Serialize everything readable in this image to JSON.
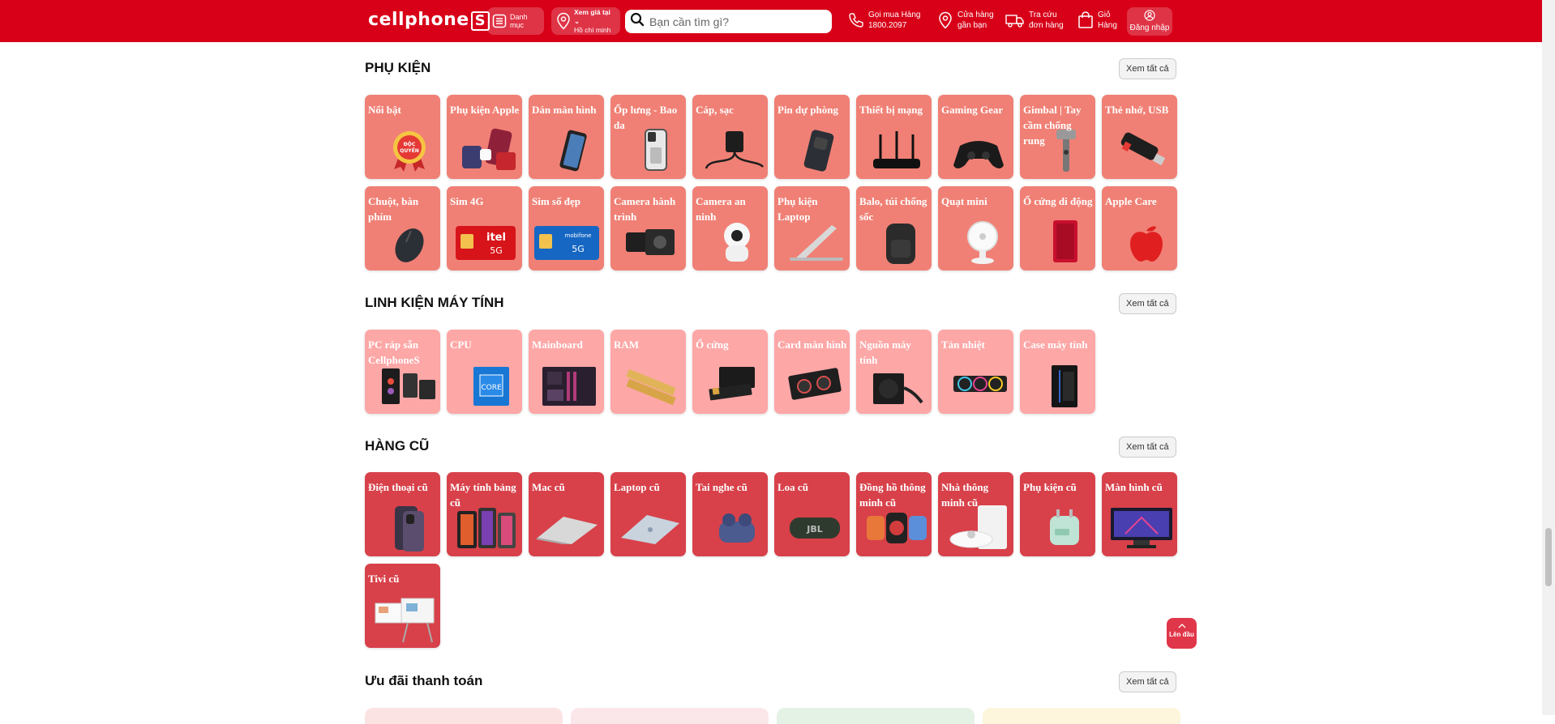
{
  "header": {
    "logo": "cellphone",
    "logo_mark": "S",
    "menu_label": "Danh mục",
    "location_line1": "Xem giá tại",
    "location_line2": "Hồ chí minh",
    "search_placeholder": "Bạn cần tìm gì?",
    "call_line1": "Gọi mua Hàng",
    "call_line2": "1800.2097",
    "store_line1": "Cửa hàng",
    "store_line2": "gần bạn",
    "track_line1": "Tra cứu",
    "track_line2": "đơn hàng",
    "cart_line1": "Giỏ",
    "cart_line2": "Hàng",
    "login_label": "Đăng nhập"
  },
  "colors": {
    "brand": "#d70018",
    "tile_accessory": "#f08075",
    "tile_pc": "#fda7a6",
    "tile_used": "#d8414a"
  },
  "view_all_label": "Xem tất cả",
  "sections": {
    "accessories": {
      "title": "PHỤ KIỆN",
      "items": [
        {
          "label": "Nổi bật",
          "icon": "badge-icon"
        },
        {
          "label": "Phụ kiện Apple",
          "icon": "apple-accessory-icon"
        },
        {
          "label": "Dán màn hình",
          "icon": "screen-protector-icon"
        },
        {
          "label": "Ốp lưng - Bao da",
          "icon": "phone-case-icon"
        },
        {
          "label": "Cáp, sạc",
          "icon": "charger-icon"
        },
        {
          "label": "Pin dự phòng",
          "icon": "power-bank-icon"
        },
        {
          "label": "Thiết bị mạng",
          "icon": "router-icon"
        },
        {
          "label": "Gaming Gear",
          "icon": "gamepad-icon"
        },
        {
          "label": "Gimbal | Tay cầm chống rung",
          "icon": "gimbal-icon"
        },
        {
          "label": "Thẻ nhớ, USB",
          "icon": "usb-icon"
        },
        {
          "label": "Chuột, bàn phím",
          "icon": "mouse-icon"
        },
        {
          "label": "Sim 4G",
          "icon": "sim-itel-icon",
          "badge": "itel",
          "badge2": "5G"
        },
        {
          "label": "Sim số đẹp",
          "icon": "sim-mobifone-icon",
          "badge": "mobifone",
          "badge2": "5G"
        },
        {
          "label": "Camera hành trình",
          "icon": "action-camera-icon"
        },
        {
          "label": "Camera an ninh",
          "icon": "security-camera-icon"
        },
        {
          "label": "Phụ kiện Laptop",
          "icon": "laptop-stand-icon"
        },
        {
          "label": "Balo, túi chống sốc",
          "icon": "backpack-icon"
        },
        {
          "label": "Quạt mini",
          "icon": "fan-icon"
        },
        {
          "label": "Ổ cứng di động",
          "icon": "portable-drive-icon"
        },
        {
          "label": "Apple Care",
          "icon": "apple-logo-icon"
        }
      ]
    },
    "pc_parts": {
      "title": "LINH KIỆN MÁY TÍNH",
      "items": [
        {
          "label": "PC ráp sẵn CellphoneS",
          "icon": "pc-build-icon"
        },
        {
          "label": "CPU",
          "icon": "cpu-icon",
          "badge": "CORE"
        },
        {
          "label": "Mainboard",
          "icon": "mainboard-icon"
        },
        {
          "label": "RAM",
          "icon": "ram-icon"
        },
        {
          "label": "Ổ cứng",
          "icon": "ssd-icon"
        },
        {
          "label": "Card màn hình",
          "icon": "gpu-icon"
        },
        {
          "label": "Nguồn máy tính",
          "icon": "psu-icon"
        },
        {
          "label": "Tản nhiệt",
          "icon": "cooler-icon"
        },
        {
          "label": "Case máy tính",
          "icon": "pc-case-icon"
        }
      ]
    },
    "used": {
      "title": "HÀNG CŨ",
      "items": [
        {
          "label": "Điện thoại cũ",
          "icon": "phone-icon"
        },
        {
          "label": "Máy tính bảng cũ",
          "icon": "tablet-icon"
        },
        {
          "label": "Mac cũ",
          "icon": "macbook-icon"
        },
        {
          "label": "Laptop cũ",
          "icon": "laptop-icon"
        },
        {
          "label": "Tai nghe cũ",
          "icon": "earbuds-icon"
        },
        {
          "label": "Loa cũ",
          "icon": "speaker-icon",
          "badge": "JBL"
        },
        {
          "label": "Đồng hồ thông minh cũ",
          "icon": "smartwatch-icon"
        },
        {
          "label": "Nhà thông minh cũ",
          "icon": "robot-vacuum-icon"
        },
        {
          "label": "Phụ kiện cũ",
          "icon": "adapter-icon"
        },
        {
          "label": "Màn hình cũ",
          "icon": "monitor-icon"
        },
        {
          "label": "Tivi cũ",
          "icon": "tv-icon"
        }
      ]
    },
    "payment": {
      "title": "Ưu đãi thanh toán"
    }
  },
  "back_to_top": "Lên đầu"
}
